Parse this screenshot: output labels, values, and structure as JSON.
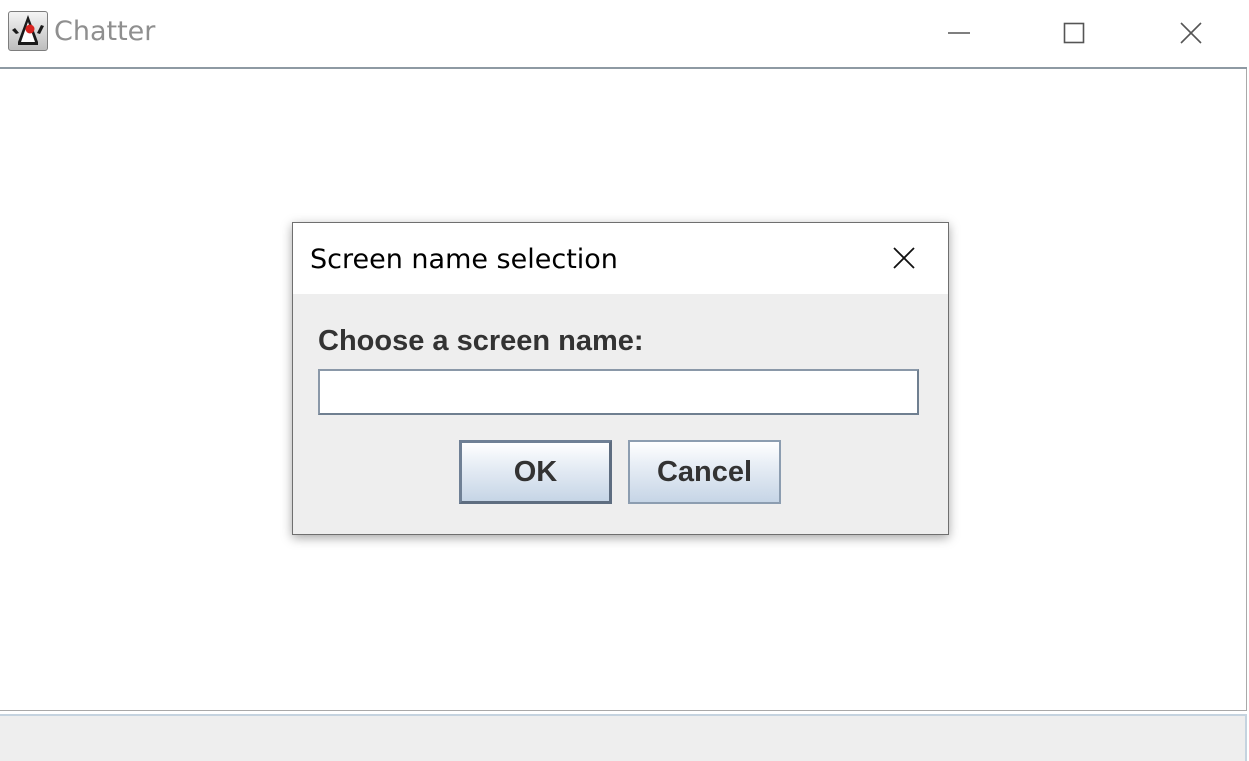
{
  "window": {
    "title": "Chatter"
  },
  "dialog": {
    "title": "Screen name selection",
    "prompt": "Choose a screen name:",
    "input_value": "",
    "ok_label": "OK",
    "cancel_label": "Cancel"
  },
  "icons": {
    "app": "java-duke-icon",
    "minimize": "minimize-icon",
    "maximize": "maximize-icon",
    "close": "close-icon"
  },
  "colors": {
    "dialog_background": "#eeeeee",
    "button_gradient_bottom": "#c6d5e6",
    "title_text_inactive": "#8f8f8f"
  }
}
